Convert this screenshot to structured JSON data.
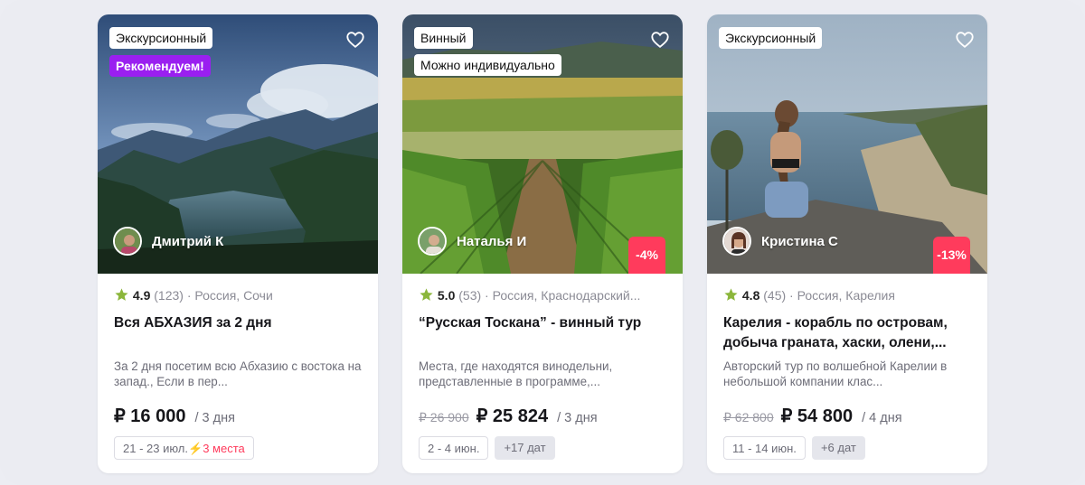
{
  "colors": {
    "accent": "#9a1ff0",
    "discount": "#ff3b5c",
    "star": "#8bb63b",
    "alert": "#ff3b5c"
  },
  "cards": [
    {
      "tags": [
        "Экскурсионный"
      ],
      "recommend": "Рекомендуем!",
      "author": "Дмитрий К",
      "rating": "4.9",
      "reviews": "(123)",
      "location": "· Россия, Сочи",
      "title": "Вся АБХАЗИЯ за 2 дня",
      "description": "За 2 дня посетим всю Абхазию с востока на запад., Если в пер...",
      "price": "₽ 16 000",
      "duration": "/ 3 дня",
      "date_range": "21 - 23 июл.",
      "seats": "3 места"
    },
    {
      "tags": [
        "Винный",
        "Можно индивидуально"
      ],
      "author": "Наталья И",
      "discount": "-4%",
      "rating": "5.0",
      "reviews": "(53)",
      "location": "· Россия, Краснодарский...",
      "title": "“Русская Тоскана” - винный тур",
      "description": "Места, где находятся винодельни, представленные в программе,...",
      "old_price": "₽ 26 900",
      "price": "₽ 25 824",
      "duration": "/ 3 дня",
      "date_range": "2 - 4 июн.",
      "more_dates": "+17 дат"
    },
    {
      "tags": [
        "Экскурсионный"
      ],
      "author": "Кристина С",
      "discount": "-13%",
      "rating": "4.8",
      "reviews": "(45)",
      "location": "· Россия, Карелия",
      "title": "Карелия - корабль по островам, добыча граната, хаски, олени,...",
      "description": "Авторский тур по волшебной Карелии в небольшой компании клас...",
      "old_price": "₽ 62 800",
      "price": "₽ 54 800",
      "duration": "/ 4 дня",
      "date_range": "11 - 14 июн.",
      "more_dates": "+6 дат"
    }
  ]
}
